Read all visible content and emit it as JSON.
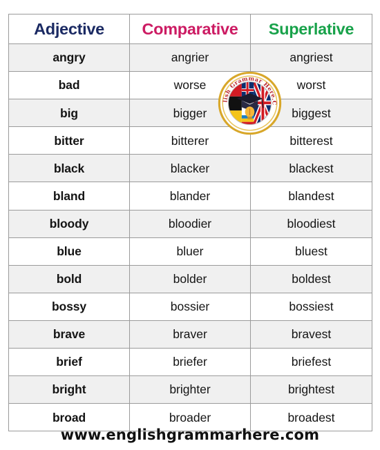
{
  "table": {
    "headers": [
      {
        "label": "Adjective",
        "color": "#1b2a63"
      },
      {
        "label": "Comparative",
        "color": "#cc1b63"
      },
      {
        "label": "Superlative",
        "color": "#18a24a"
      }
    ],
    "rows": [
      {
        "adjective": "angry",
        "comparative": "angrier",
        "superlative": "angriest"
      },
      {
        "adjective": "bad",
        "comparative": "worse",
        "superlative": "worst"
      },
      {
        "adjective": "big",
        "comparative": "bigger",
        "superlative": "biggest"
      },
      {
        "adjective": "bitter",
        "comparative": "bitterer",
        "superlative": "bitterest"
      },
      {
        "adjective": "black",
        "comparative": "blacker",
        "superlative": "blackest"
      },
      {
        "adjective": "bland",
        "comparative": "blander",
        "superlative": "blandest"
      },
      {
        "adjective": "bloody",
        "comparative": "bloodier",
        "superlative": "bloodiest"
      },
      {
        "adjective": "blue",
        "comparative": "bluer",
        "superlative": "bluest"
      },
      {
        "adjective": "bold",
        "comparative": "bolder",
        "superlative": "boldest"
      },
      {
        "adjective": "bossy",
        "comparative": "bossier",
        "superlative": "bossiest"
      },
      {
        "adjective": "brave",
        "comparative": "braver",
        "superlative": "bravest"
      },
      {
        "adjective": "brief",
        "comparative": "briefer",
        "superlative": "briefest"
      },
      {
        "adjective": "bright",
        "comparative": "brighter",
        "superlative": "brightest"
      },
      {
        "adjective": "broad",
        "comparative": "broader",
        "superlative": "broadest"
      }
    ]
  },
  "logo": {
    "icon": "english-grammar-here-badge-icon",
    "arc_text": "English Grammar Here.Com",
    "ring_color": "#d8a72a",
    "text_color": "#b8232b"
  },
  "footer": {
    "url": "www.englishgrammarhere.com"
  }
}
